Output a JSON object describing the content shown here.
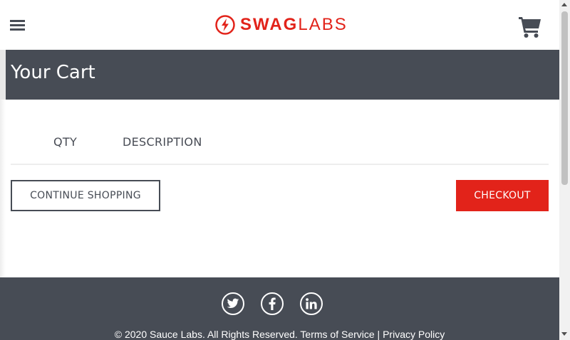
{
  "header": {
    "logo_bold": "SWAG",
    "logo_light": "LABS",
    "menu_icon": "hamburger-menu-icon",
    "cart_icon": "shopping-cart-icon"
  },
  "subheader": {
    "title": "Your Cart"
  },
  "cart": {
    "qty_label": "QTY",
    "description_label": "DESCRIPTION",
    "continue_label": "CONTINUE SHOPPING",
    "checkout_label": "CHECKOUT"
  },
  "footer": {
    "social": [
      "twitter-icon",
      "facebook-icon",
      "linkedin-icon"
    ],
    "copyright": "© 2020 Sauce Labs. All Rights Reserved. Terms of Service | Privacy Policy"
  },
  "colors": {
    "brand": "#e2231a",
    "dark": "#474c55"
  }
}
